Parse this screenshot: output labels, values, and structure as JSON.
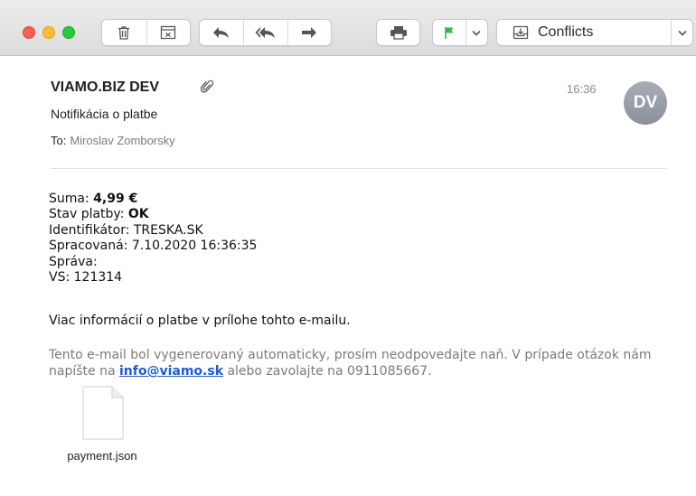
{
  "window": {
    "mailbox": "Conflicts"
  },
  "toolbar": {
    "icons": [
      "trash-icon",
      "archive-icon",
      "reply-icon",
      "reply-all-icon",
      "forward-icon",
      "print-icon",
      "flag-icon",
      "chevron-down-icon",
      "mailbox-icon"
    ],
    "flag_color": "#3bb54a"
  },
  "message": {
    "sender": "VIAMO.BIZ DEV",
    "subject": "Notifikácia o platbe",
    "to_label": "To:",
    "to_value": "Miroslav Zomborsky",
    "time": "16:36",
    "avatar_initials": "DV"
  },
  "body": {
    "suma_label": "Suma:",
    "suma_value": "4,99 €",
    "stav_label": "Stav platby:",
    "stav_value": "OK",
    "identifikator": "Identifikátor: TRESKA.SK",
    "spracovana": "Spracovaná: 7.10.2020 16:36:35",
    "sprava": "Správa:",
    "vs": "VS: 121314",
    "more_info": "Viac informácií o platbe v prílohe tohto e-mailu.",
    "footer_part1": "Tento e-mail bol vygenerovaný automaticky, prosím neodpovedajte naň. V prípade otázok nám napíšte na",
    "footer_link": "info@viamo.sk",
    "footer_part2": "alebo zavolajte na 0911085667."
  },
  "attachment": {
    "filename": "payment.json"
  }
}
